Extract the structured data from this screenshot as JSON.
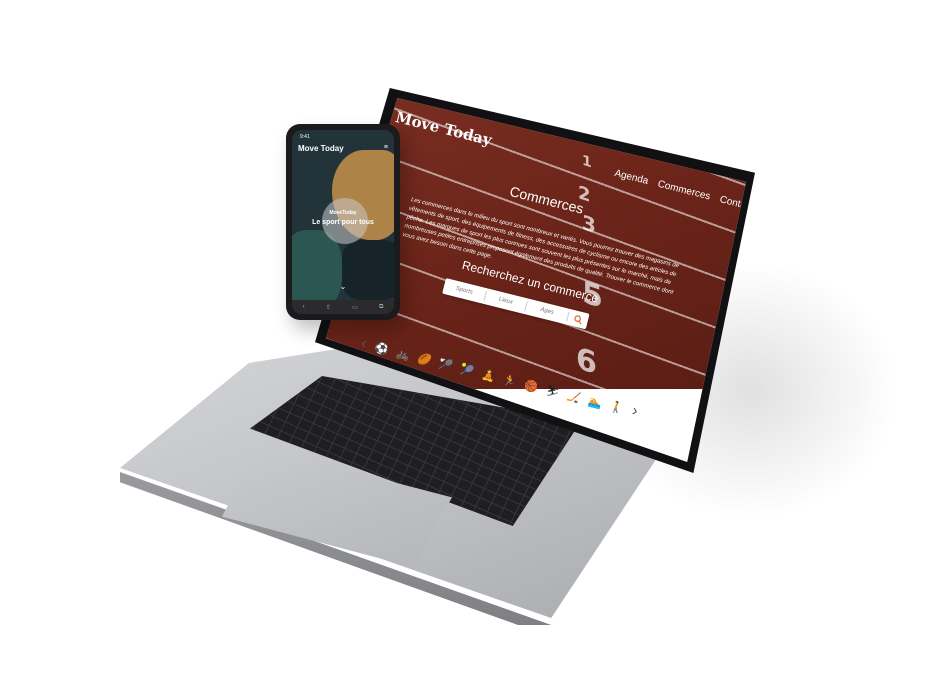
{
  "site": {
    "logo": "Move Today",
    "nav": [
      "Agenda",
      "Commerces",
      "Contact"
    ],
    "accent_color": "#e46a33",
    "hero_color": "#6b2419"
  },
  "hero": {
    "title": "Commerces",
    "text": "Les commerces dans le milieu du sport sont nombreux et variés. Vous pourrez trouver des magasins de vêtements de sport, des équipements de fitness, des accessoires de cyclisme ou encore des articles de pêche. Les marques de sport les plus connues sont souvent les plus présentes sur le marché, mais de nombreuses petites entreprises proposent également des produits de qualité. Trouver le commerce dont vous avez besoin dans cette page.",
    "lane_numbers": [
      "1",
      "2",
      "3",
      "5",
      "6"
    ]
  },
  "search": {
    "title": "Recherchez un commerce",
    "fields": [
      "Sports",
      "Lieux",
      "Ages"
    ],
    "button_icon": "search-icon"
  },
  "sports": {
    "prev_label": "‹",
    "next_label": "›",
    "icons": [
      {
        "name": "soccer-icon",
        "glyph": "⚽"
      },
      {
        "name": "cycling-icon",
        "glyph": "🚲"
      },
      {
        "name": "rugby-icon",
        "glyph": "🏉"
      },
      {
        "name": "badminton-icon",
        "glyph": "🏸"
      },
      {
        "name": "tennis-icon",
        "glyph": "🎾"
      },
      {
        "name": "yoga-icon",
        "glyph": "🧘"
      },
      {
        "name": "running-icon",
        "glyph": "🏃"
      },
      {
        "name": "basketball-icon",
        "glyph": "🏀",
        "active": true
      },
      {
        "name": "skiing-icon",
        "glyph": "⛷"
      },
      {
        "name": "hockey-icon",
        "glyph": "🏒"
      },
      {
        "name": "swimming-icon",
        "glyph": "🏊"
      },
      {
        "name": "walking-icon",
        "glyph": "🚶"
      }
    ]
  },
  "phone": {
    "status_time": "9:41",
    "logo": "Move Today",
    "brand": "MoveToday",
    "tagline": "Le sport pour tous"
  }
}
